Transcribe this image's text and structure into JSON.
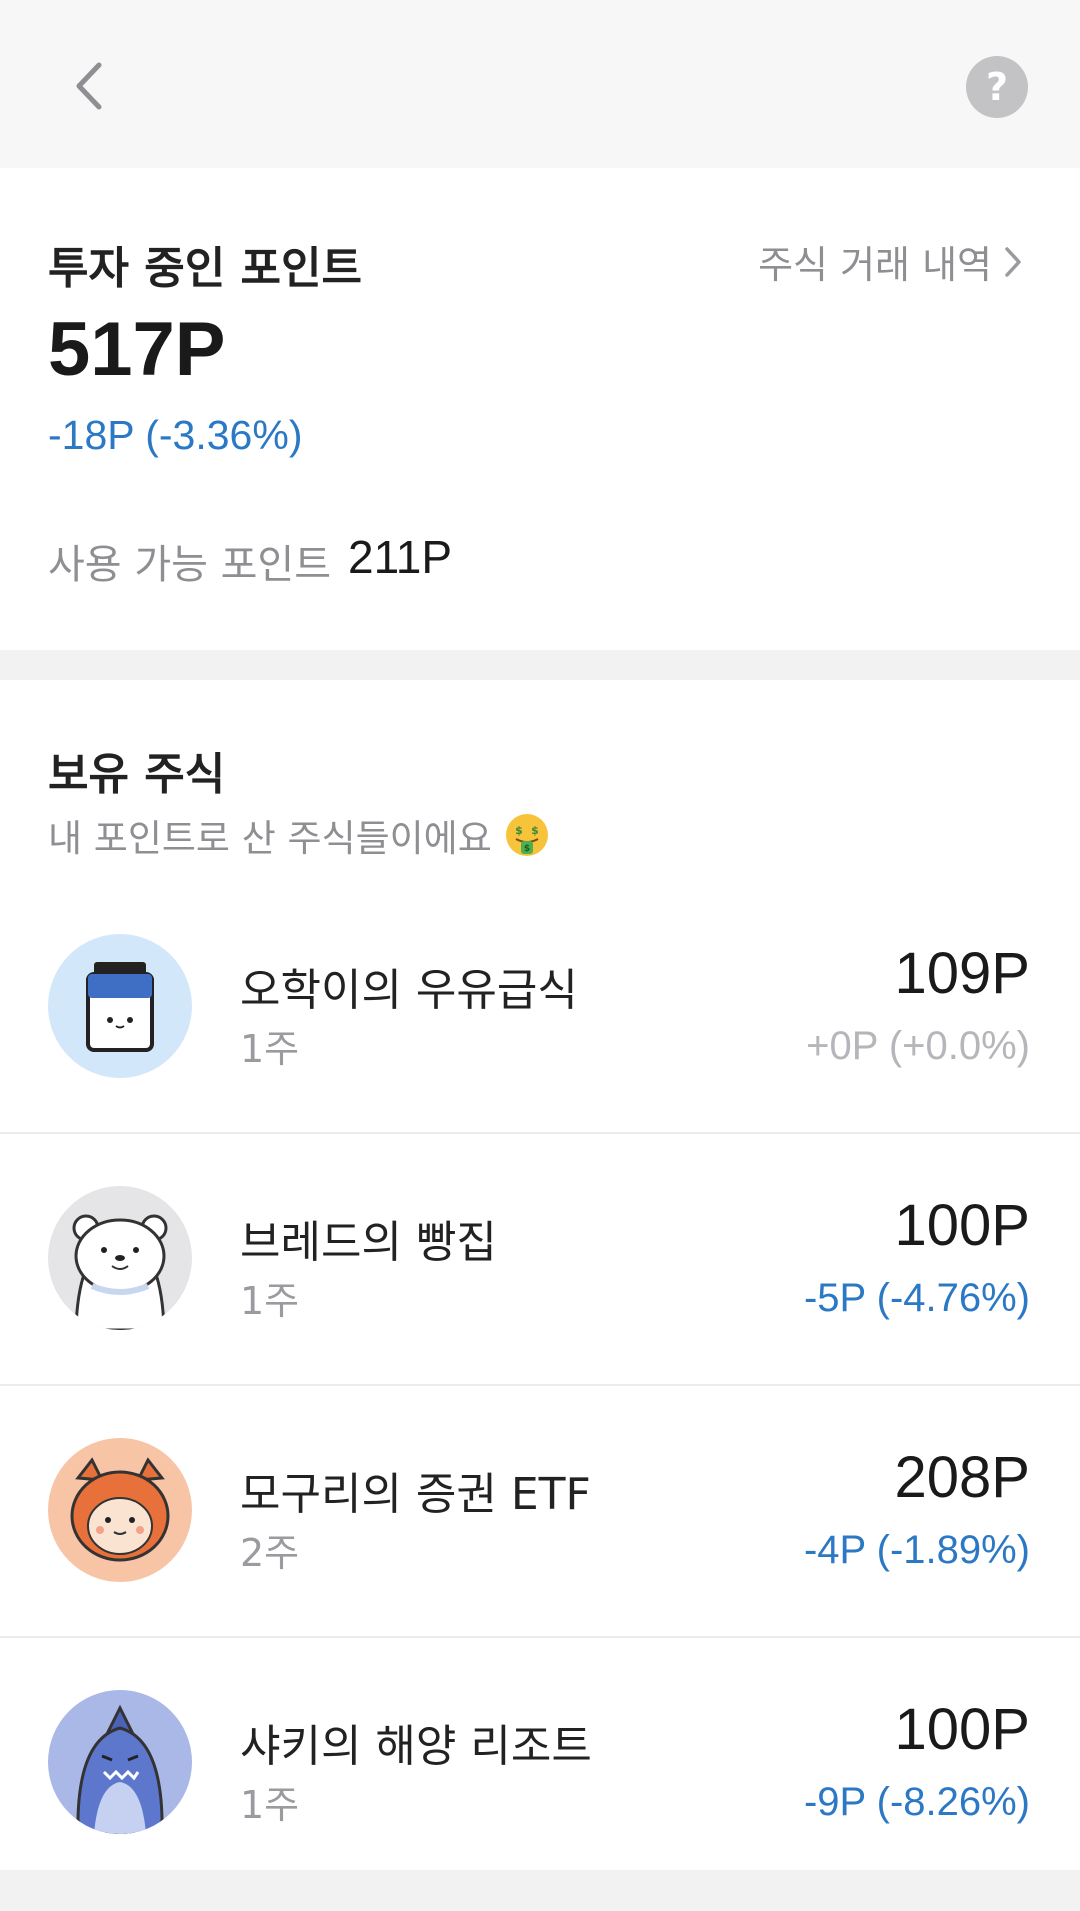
{
  "header": {
    "back_icon": "chevron-left-icon",
    "help_icon": "question-circle-icon",
    "help_glyph": "?"
  },
  "summary": {
    "title": "투자 중인 포인트",
    "history_link": "주식 거래 내역",
    "total_points": "517P",
    "total_change": "-18P (-3.36%)",
    "available_label": "사용 가능 포인트",
    "available_value": "211P"
  },
  "holdings": {
    "title": "보유 주식",
    "subtitle": "내 포인트로 산 주식들이에요",
    "subtitle_emoji": "money-mouth-face",
    "items": [
      {
        "name": "오학이의 우유급식",
        "quantity": "1주",
        "value": "109P",
        "change": "+0P (+0.0%)",
        "change_color": "#b6b6ba",
        "avatar": "milk-carton",
        "avatar_bg": "#d3e7fb"
      },
      {
        "name": "브레드의 빵집",
        "quantity": "1주",
        "value": "100P",
        "change": "-5P (-4.76%)",
        "change_color": "#2b78c5",
        "avatar": "polar-bear",
        "avatar_bg": "#e5e5e7"
      },
      {
        "name": "모구리의 증권 ETF",
        "quantity": "2주",
        "value": "208P",
        "change": "-4P (-1.89%)",
        "change_color": "#2b78c5",
        "avatar": "raccoon",
        "avatar_bg": "#f7c5a6"
      },
      {
        "name": "샤키의 해양 리조트",
        "quantity": "1주",
        "value": "100P",
        "change": "-9P (-8.26%)",
        "change_color": "#2b78c5",
        "avatar": "shark",
        "avatar_bg": "#a9b8e6"
      }
    ]
  },
  "colors": {
    "accent_blue": "#2b78c5",
    "neutral_change": "#b6b6ba",
    "secondary_text": "#8e8e93",
    "page_background": "#f2f2f3"
  }
}
